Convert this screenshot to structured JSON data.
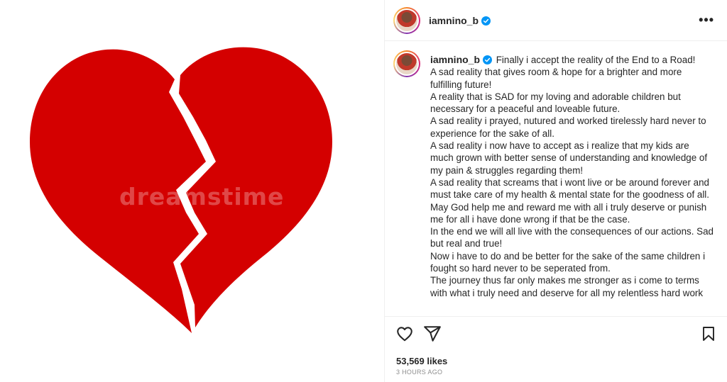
{
  "media": {
    "heart_color": "#d40000",
    "watermark": "dreamstime"
  },
  "post": {
    "username": "iamnino_b",
    "verified_color": "#0095f6",
    "caption": "Finally i accept the reality of the End to a Road!\nA sad reality that gives room & hope for a brighter and more fulfilling future!\nA reality that is SAD for my loving and adorable children but necessary for a peaceful and loveable future.\nA sad reality i prayed, nutured and worked tirelessly hard never to experience for the sake of all.\nA sad reality i now have to accept as i realize that my kids are much grown with better sense of understanding and knowledge of my pain & struggles regarding them!\nA sad reality that screams that i wont live or be around forever and must take care of my health & mental state for the goodness of all.\nMay God help me and reward me with all i truly deserve or punish me for all i have done wrong if that be the case.\nIn the end we will all live with the consequences of our actions. Sad but real and true!\nNow i have to do and be better for the sake of the same children i fought so hard never to be seperated from.\nThe journey thus far only makes me stronger as i come to terms with what i truly need and deserve for all my relentless hard work",
    "likes": "53,569 likes",
    "timestamp": "3 HOURS AGO"
  },
  "icons": {
    "more": "more-options-icon",
    "like": "heart-outline-icon",
    "share": "paper-plane-icon",
    "save": "bookmark-icon"
  }
}
